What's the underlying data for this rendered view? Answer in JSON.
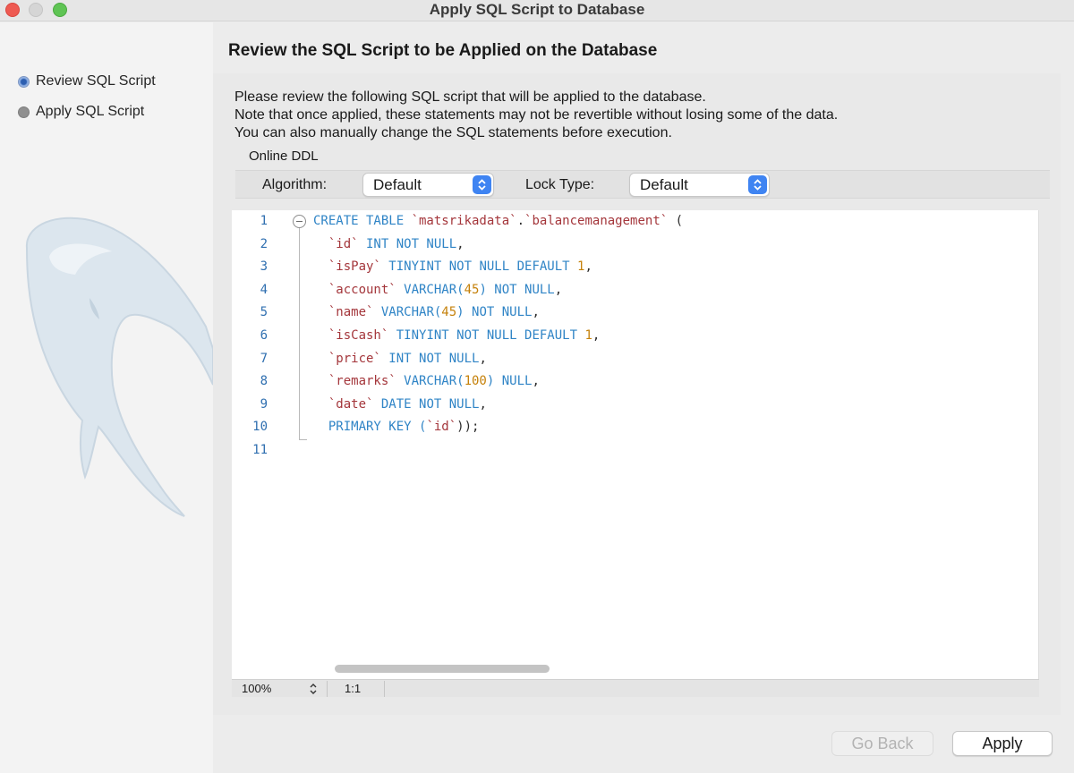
{
  "window": {
    "title": "Apply SQL Script to Database"
  },
  "sidebar": {
    "steps": [
      {
        "label": "Review SQL Script",
        "state": "active"
      },
      {
        "label": "Apply SQL Script",
        "state": "inactive"
      }
    ],
    "watermark": "dolphin-logo"
  },
  "main": {
    "heading": "Review the SQL Script to be Applied on the Database",
    "description": [
      "Please review the following SQL script that will be applied to the database.",
      "Note that once applied, these statements may not be revertible without losing some of the data.",
      "You can also manually change the SQL statements before execution."
    ],
    "online_ddl": {
      "title": "Online DDL",
      "algorithm_label": "Algorithm:",
      "algorithm_value": "Default",
      "lock_type_label": "Lock Type:",
      "lock_type_value": "Default"
    },
    "editor": {
      "line_numbers": [
        "1",
        "2",
        "3",
        "4",
        "5",
        "6",
        "7",
        "8",
        "9",
        "10",
        "11"
      ],
      "lines": [
        [
          {
            "t": "CREATE TABLE ",
            "c": "kw"
          },
          {
            "t": "`matsrikadata`",
            "c": "id"
          },
          {
            "t": ".",
            "c": "punc"
          },
          {
            "t": "`balancemanagement`",
            "c": "id"
          },
          {
            "t": " (",
            "c": "punc"
          }
        ],
        [
          {
            "t": "  ",
            "c": "punc"
          },
          {
            "t": "`id`",
            "c": "id"
          },
          {
            "t": " INT NOT NULL",
            "c": "kw"
          },
          {
            "t": ",",
            "c": "punc"
          }
        ],
        [
          {
            "t": "  ",
            "c": "punc"
          },
          {
            "t": "`isPay`",
            "c": "id"
          },
          {
            "t": " TINYINT NOT NULL DEFAULT ",
            "c": "kw"
          },
          {
            "t": "1",
            "c": "num"
          },
          {
            "t": ",",
            "c": "punc"
          }
        ],
        [
          {
            "t": "  ",
            "c": "punc"
          },
          {
            "t": "`account`",
            "c": "id"
          },
          {
            "t": " VARCHAR(",
            "c": "kw"
          },
          {
            "t": "45",
            "c": "num"
          },
          {
            "t": ") NOT NULL",
            "c": "kw"
          },
          {
            "t": ",",
            "c": "punc"
          }
        ],
        [
          {
            "t": "  ",
            "c": "punc"
          },
          {
            "t": "`name`",
            "c": "id"
          },
          {
            "t": " VARCHAR(",
            "c": "kw"
          },
          {
            "t": "45",
            "c": "num"
          },
          {
            "t": ") NOT NULL",
            "c": "kw"
          },
          {
            "t": ",",
            "c": "punc"
          }
        ],
        [
          {
            "t": "  ",
            "c": "punc"
          },
          {
            "t": "`isCash`",
            "c": "id"
          },
          {
            "t": " TINYINT NOT NULL DEFAULT ",
            "c": "kw"
          },
          {
            "t": "1",
            "c": "num"
          },
          {
            "t": ",",
            "c": "punc"
          }
        ],
        [
          {
            "t": "  ",
            "c": "punc"
          },
          {
            "t": "`price`",
            "c": "id"
          },
          {
            "t": " INT NOT NULL",
            "c": "kw"
          },
          {
            "t": ",",
            "c": "punc"
          }
        ],
        [
          {
            "t": "  ",
            "c": "punc"
          },
          {
            "t": "`remarks`",
            "c": "id"
          },
          {
            "t": " VARCHAR(",
            "c": "kw"
          },
          {
            "t": "100",
            "c": "num"
          },
          {
            "t": ") NULL",
            "c": "kw"
          },
          {
            "t": ",",
            "c": "punc"
          }
        ],
        [
          {
            "t": "  ",
            "c": "punc"
          },
          {
            "t": "`date`",
            "c": "id"
          },
          {
            "t": " DATE NOT NULL",
            "c": "kw"
          },
          {
            "t": ",",
            "c": "punc"
          }
        ],
        [
          {
            "t": "  PRIMARY KEY (",
            "c": "kw"
          },
          {
            "t": "`id`",
            "c": "id"
          },
          {
            "t": "));",
            "c": "punc"
          }
        ],
        []
      ],
      "zoom": "100%",
      "cursor_position": "1:1"
    }
  },
  "footer": {
    "back_label": "Go Back",
    "apply_label": "Apply"
  },
  "colors": {
    "keyword": "#2f84c6",
    "identifier": "#a4363b",
    "number": "#c5810a",
    "accent": "#3f84f2"
  }
}
